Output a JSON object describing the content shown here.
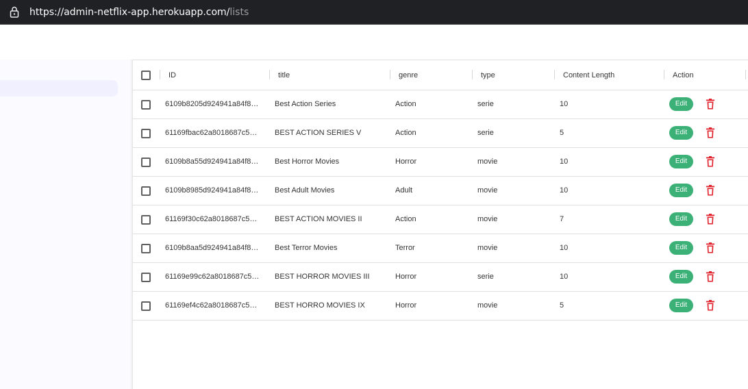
{
  "browser": {
    "url_main": "https://admin-netflix-app.herokuapp.com/",
    "url_rest": "lists"
  },
  "table": {
    "columns": [
      "ID",
      "title",
      "genre",
      "type",
      "Content Length",
      "Action"
    ],
    "edit_label": "Edit",
    "rows": [
      {
        "id": "6109b8205d924941a84f8…",
        "title": "Best Action Series",
        "genre": "Action",
        "type": "serie",
        "length": "10"
      },
      {
        "id": "61169fbac62a8018687c5…",
        "title": "BEST ACTION SERIES V",
        "genre": "Action",
        "type": "serie",
        "length": "5"
      },
      {
        "id": "6109b8a55d924941a84f8…",
        "title": "Best Horror Movies",
        "genre": "Horror",
        "type": "movie",
        "length": "10"
      },
      {
        "id": "6109b8985d924941a84f8…",
        "title": "Best Adult Movies",
        "genre": "Adult",
        "type": "movie",
        "length": "10"
      },
      {
        "id": "61169f30c62a8018687c5…",
        "title": "BEST ACTION MOVIES II",
        "genre": "Action",
        "type": "movie",
        "length": "7"
      },
      {
        "id": "6109b8aa5d924941a84f8…",
        "title": "Best Terror Movies",
        "genre": "Terror",
        "type": "movie",
        "length": "10"
      },
      {
        "id": "61169e99c62a8018687c5…",
        "title": "BEST HORROR MOVIES III",
        "genre": "Horror",
        "type": "serie",
        "length": "10"
      },
      {
        "id": "61169ef4c62a8018687c5…",
        "title": "BEST HORRO MOVIES IX",
        "genre": "Horror",
        "type": "movie",
        "length": "5"
      }
    ]
  },
  "colors": {
    "edit": "#3bb077",
    "delete": "#e0202a",
    "chrome": "#202124"
  }
}
